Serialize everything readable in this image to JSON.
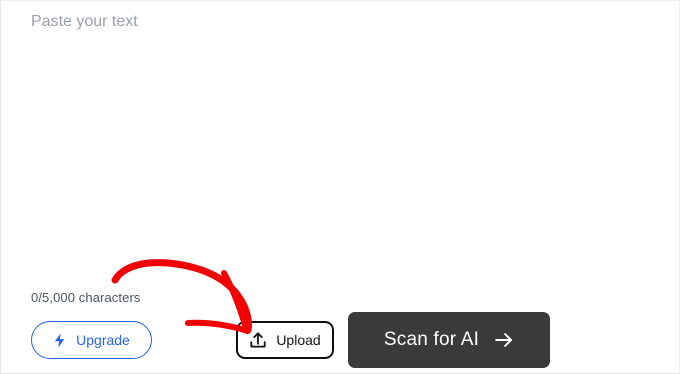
{
  "editor": {
    "placeholder": "Paste your text",
    "value": "",
    "char_count": "0/5,000 characters"
  },
  "actions": {
    "upgrade_label": "Upgrade",
    "upload_label": "Upload",
    "scan_label": "Scan for AI"
  },
  "icons": {
    "upgrade": "lightning-bolt-icon",
    "upload": "upload-tray-icon",
    "scan": "arrow-right-icon"
  },
  "colors": {
    "upgrade_accent": "#2563eb",
    "scan_button_bg": "#3a3a3a",
    "annotation_arrow": "#f20000",
    "placeholder_text": "#9aa0ab"
  }
}
